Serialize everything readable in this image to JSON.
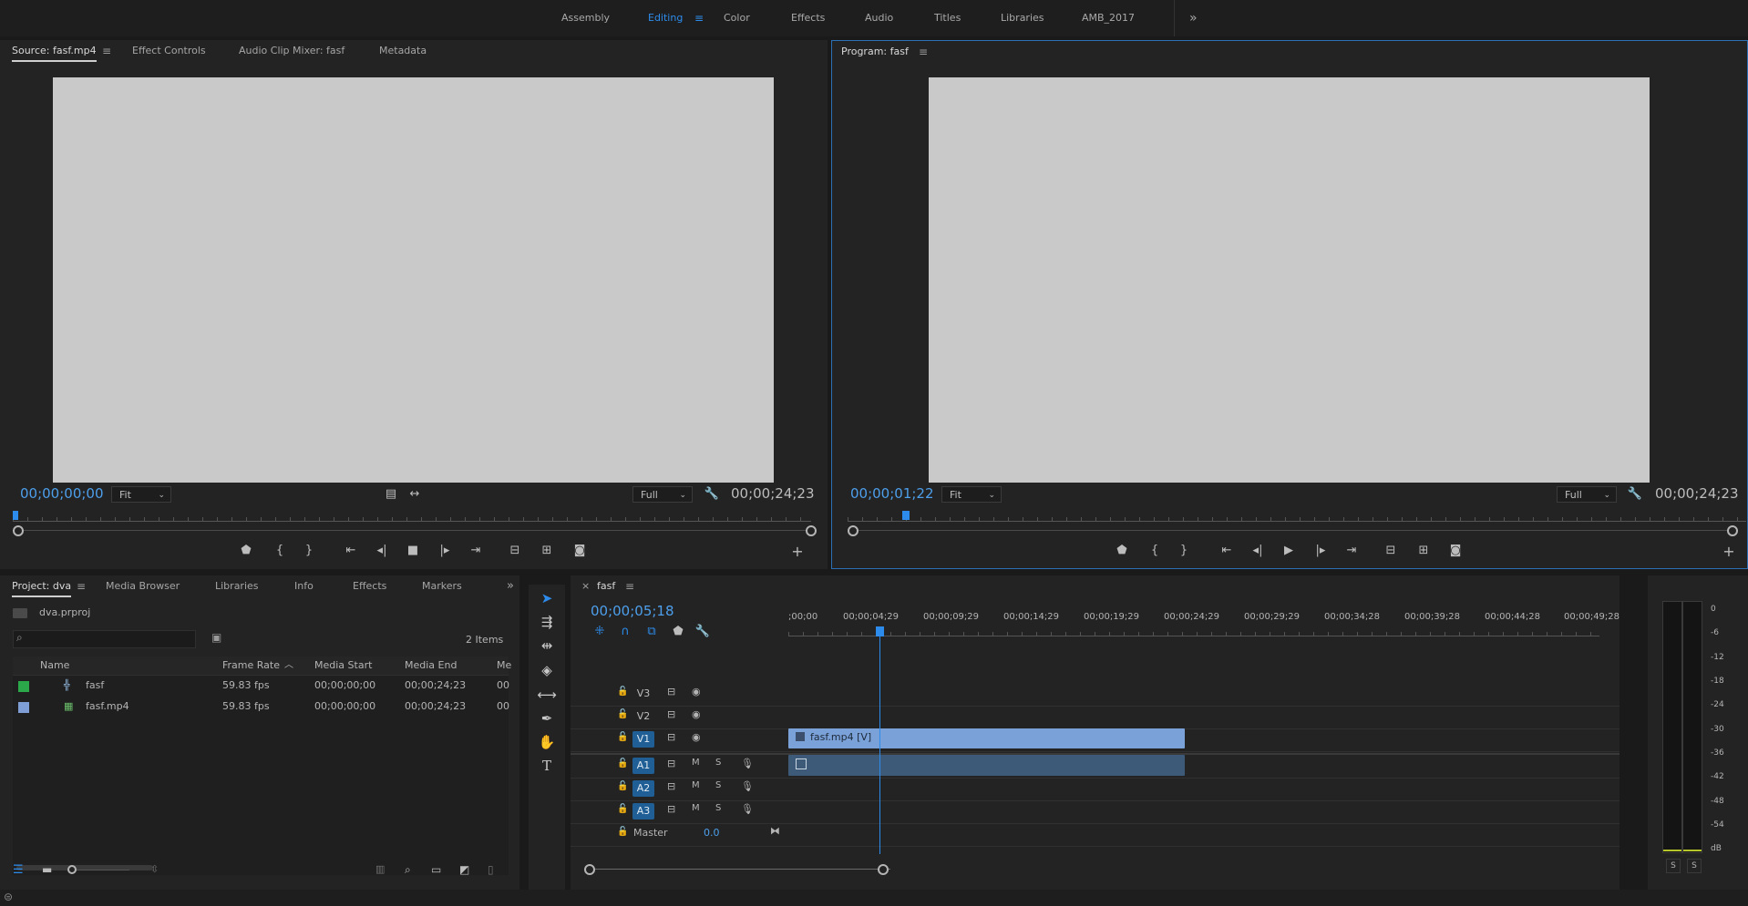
{
  "workspaces": {
    "tabs": [
      "Assembly",
      "Editing",
      "Color",
      "Effects",
      "Audio",
      "Titles",
      "Libraries",
      "AMB_2017"
    ],
    "active": "Editing",
    "overflow": "»"
  },
  "source_panel": {
    "tabs": [
      "Source: fasf.mp4",
      "Effect Controls",
      "Audio Clip Mixer: fasf",
      "Metadata"
    ],
    "timecode": "00;00;00;00",
    "fit": "Fit",
    "resolution": "Full",
    "duration": "00;00;24;23"
  },
  "program_panel": {
    "title": "Program: fasf",
    "timecode": "00;00;01;22",
    "fit": "Fit",
    "resolution": "Full",
    "duration": "00;00;24;23"
  },
  "project_panel": {
    "tabs": [
      "Project: dva",
      "Media Browser",
      "Libraries",
      "Info",
      "Effects",
      "Markers"
    ],
    "project_file": "dva.prproj",
    "items_count": "2 Items",
    "columns": [
      "Name",
      "Frame Rate",
      "Media Start",
      "Media End",
      "Me"
    ],
    "rows": [
      {
        "name": "fasf",
        "frame_rate": "59.83 fps",
        "media_start": "00;00;00;00",
        "media_end": "00;00;24;23",
        "me": "00",
        "color": "#2aa84a"
      },
      {
        "name": "fasf.mp4",
        "frame_rate": "59.83 fps",
        "media_start": "00;00;00;00",
        "media_end": "00;00;24;23",
        "me": "00",
        "color": "#7f9ed6"
      }
    ]
  },
  "timeline": {
    "sequence": "fasf",
    "close": "×",
    "timecode": "00;00;05;18",
    "ruler": [
      ";00;00",
      "00;00;04;29",
      "00;00;09;29",
      "00;00;14;29",
      "00;00;19;29",
      "00;00;24;29",
      "00;00;29;29",
      "00;00;34;28",
      "00;00;39;28",
      "00;00;44;28",
      "00;00;49;28"
    ],
    "video_tracks": [
      "V3",
      "V2",
      "V1"
    ],
    "audio_tracks": [
      "A1",
      "A2",
      "A3"
    ],
    "mute": "M",
    "solo": "S",
    "master_label": "Master",
    "master_value": "0.0",
    "clip_label": "fasf.mp4 [V]"
  },
  "meter": {
    "scale": [
      "0",
      "-6",
      "-12",
      "-18",
      "-24",
      "-30",
      "-36",
      "-42",
      "-48",
      "-54",
      "dB"
    ],
    "solo_left": "S",
    "solo_right": "S"
  },
  "colors": {
    "accent": "#2d8ceb",
    "clip_video": "#7aa1d8",
    "track_active": "#1f5f95"
  }
}
